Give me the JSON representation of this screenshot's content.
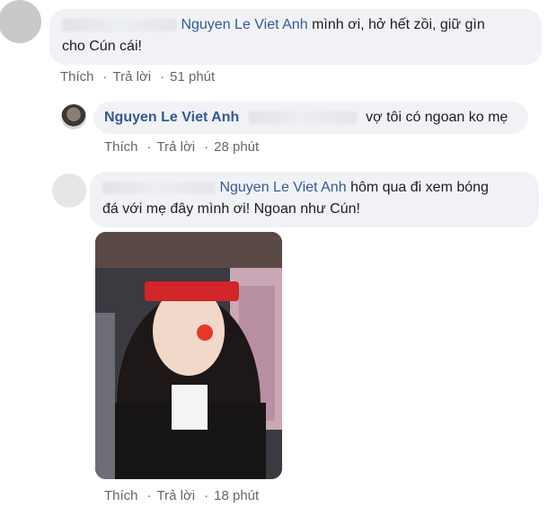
{
  "comments": [
    {
      "mention": "Nguyen Le Viet Anh",
      "text_line1": "mình ơi, hở hết zồi, giữ gìn",
      "text_line2": "cho Cún cái!",
      "actions": {
        "like": "Thích",
        "reply": "Trả lời",
        "time": "51 phút"
      }
    },
    {
      "author": "Nguyen Le Viet Anh",
      "text": "vợ tôi có ngoan ko mẹ",
      "actions": {
        "like": "Thích",
        "reply": "Trả lời",
        "time": "28 phút"
      }
    },
    {
      "mention": "Nguyen Le Viet Anh",
      "text_line1": "hôm qua đi xem bóng",
      "text_line2": "đá với mẹ đây mình ơi! Ngoan như Cún!",
      "actions": {
        "like": "Thích",
        "reply": "Trả lời",
        "time": "18 phút"
      }
    }
  ],
  "separator": "·"
}
